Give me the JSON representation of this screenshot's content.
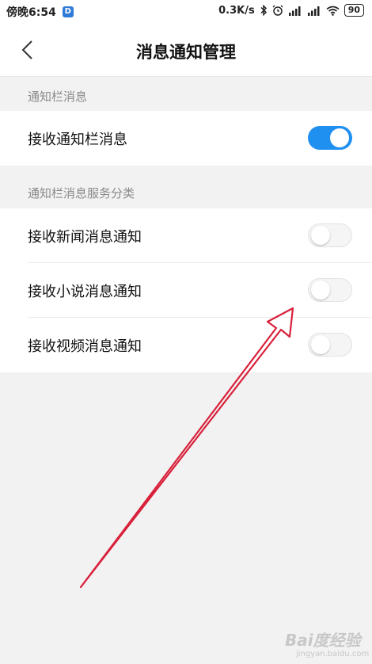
{
  "status_bar": {
    "time": "傍晚6:54",
    "app_badge": "D",
    "network_speed": "0.3K/s",
    "battery": "90"
  },
  "header": {
    "title": "消息通知管理"
  },
  "sections": {
    "notification_bar": {
      "label": "通知栏消息",
      "rows": [
        {
          "label": "接收通知栏消息",
          "enabled": true
        }
      ]
    },
    "categories": {
      "label": "通知栏消息服务分类",
      "rows": [
        {
          "label": "接收新闻消息通知",
          "enabled": false
        },
        {
          "label": "接收小说消息通知",
          "enabled": false
        },
        {
          "label": "接收视频消息通知",
          "enabled": false
        }
      ]
    }
  },
  "annotation": {
    "color": "#d8203a"
  },
  "watermark": {
    "text": "Bai度经验",
    "sub": "jingyan.baidu.com"
  },
  "colors": {
    "toggle_on": "#1f8ff0",
    "toggle_off": "#f5f5f5",
    "background": "#f2f2f2"
  }
}
